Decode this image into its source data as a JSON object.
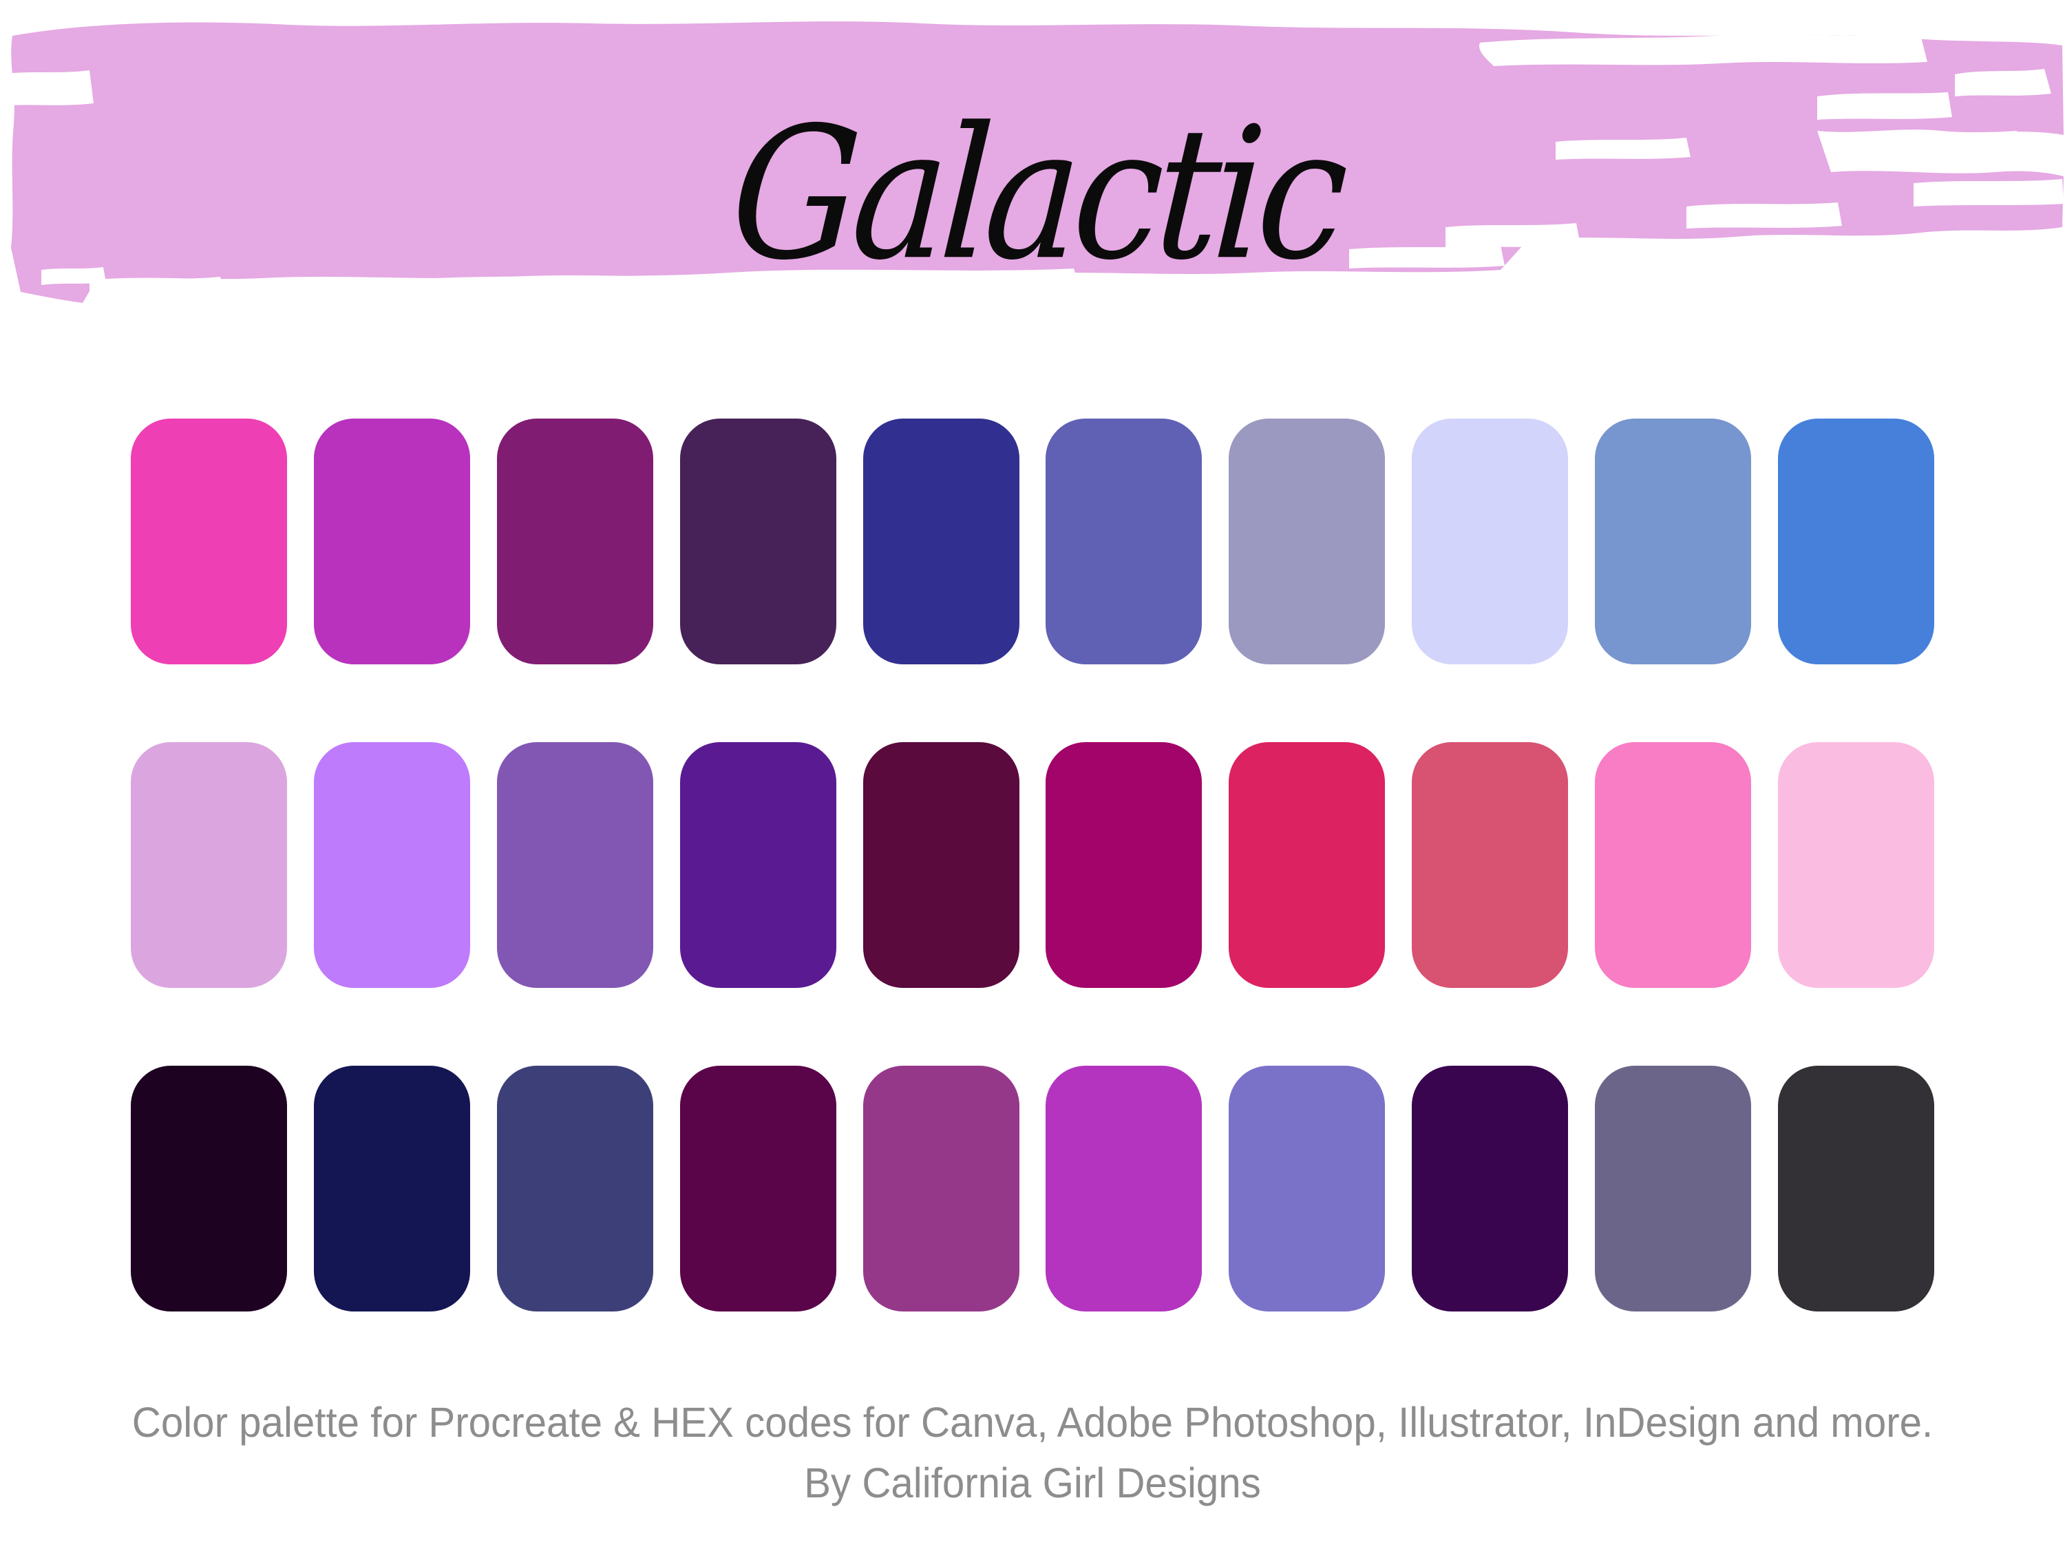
{
  "header": {
    "title": "Galactic",
    "brush_color": "#E5A9E3",
    "title_color": "#0B0B0B"
  },
  "footer": {
    "line1": "Color palette for Procreate & HEX codes for Canva, Adobe Photoshop, Illustrator, InDesign and more.",
    "line2": "By California Girl Designs",
    "text_color": "#8D8D8D"
  },
  "palette": {
    "rows": 3,
    "columns": 10,
    "total_swatches": 30,
    "background": "#FFFFFF",
    "swatch_shape": "rounded-rectangle",
    "row1": [
      {
        "name": "hot-pink",
        "hex": "#EE3FB4"
      },
      {
        "name": "magenta-purple",
        "hex": "#B832BE"
      },
      {
        "name": "plum",
        "hex": "#811C73"
      },
      {
        "name": "dark-purple",
        "hex": "#472258"
      },
      {
        "name": "deep-indigo-blue",
        "hex": "#313090"
      },
      {
        "name": "medium-blue-violet",
        "hex": "#6061B4"
      },
      {
        "name": "muted-lavender-gray",
        "hex": "#9B99C0"
      },
      {
        "name": "pale-periwinkle",
        "hex": "#D3D4FB"
      },
      {
        "name": "steel-blue",
        "hex": "#7795CE"
      },
      {
        "name": "bright-azure-blue",
        "hex": "#4680DB"
      }
    ],
    "row2": [
      {
        "name": "light-orchid",
        "hex": "#DBA6DF"
      },
      {
        "name": "bright-lavender",
        "hex": "#BE7BFB"
      },
      {
        "name": "medium-purple",
        "hex": "#8257B4"
      },
      {
        "name": "deep-violet",
        "hex": "#5A1B92"
      },
      {
        "name": "dark-wine-purple",
        "hex": "#5A0A3C"
      },
      {
        "name": "deep-magenta",
        "hex": "#A30469"
      },
      {
        "name": "crimson-pink",
        "hex": "#DC2260"
      },
      {
        "name": "dusty-rose",
        "hex": "#D85272"
      },
      {
        "name": "bubblegum-pink",
        "hex": "#F87DC4"
      },
      {
        "name": "pale-pink",
        "hex": "#FBBCE2"
      }
    ],
    "row3": [
      {
        "name": "near-black-purple",
        "hex": "#1E0222"
      },
      {
        "name": "dark-navy",
        "hex": "#141653"
      },
      {
        "name": "slate-blue",
        "hex": "#3D4078"
      },
      {
        "name": "dark-plum",
        "hex": "#5A0449"
      },
      {
        "name": "orchid-purple",
        "hex": "#96388A"
      },
      {
        "name": "vivid-purple",
        "hex": "#B434C0"
      },
      {
        "name": "periwinkle-violet",
        "hex": "#7A72C9"
      },
      {
        "name": "deep-indigo-violet",
        "hex": "#39054F"
      },
      {
        "name": "gray-purple",
        "hex": "#6B6689"
      },
      {
        "name": "charcoal",
        "hex": "#333136"
      }
    ]
  }
}
